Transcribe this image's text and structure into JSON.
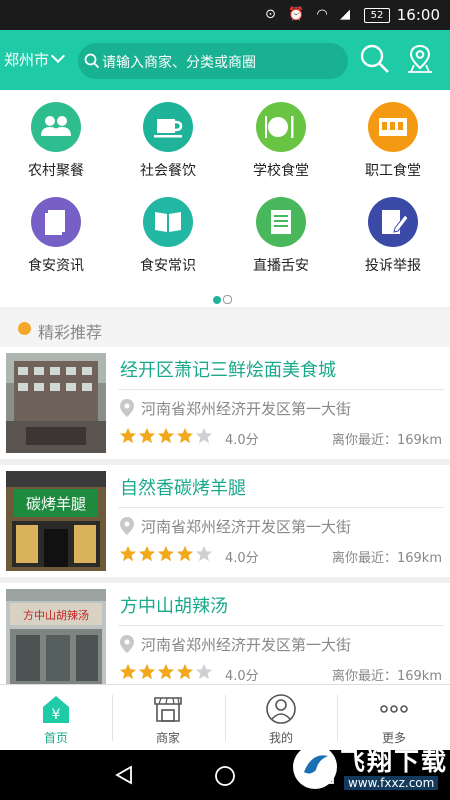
{
  "status_bar": {
    "battery": "52",
    "time": "16:00"
  },
  "header": {
    "city": "郑州市",
    "search_placeholder": "请输入商家、分类或商圈"
  },
  "categories": [
    {
      "label": "农村聚餐",
      "color": "#2ebd8e",
      "icon": "people-icon"
    },
    {
      "label": "社会餐饮",
      "color": "#1fb39a",
      "icon": "cup-icon"
    },
    {
      "label": "学校食堂",
      "color": "#6ac444",
      "icon": "plate-icon"
    },
    {
      "label": "职工食堂",
      "color": "#f49a12",
      "icon": "canteen-icon"
    },
    {
      "label": "食安资讯",
      "color": "#7660c6",
      "icon": "document-icon"
    },
    {
      "label": "食安常识",
      "color": "#21b7a3",
      "icon": "book-icon"
    },
    {
      "label": "直播舌安",
      "color": "#49b85c",
      "icon": "list-icon"
    },
    {
      "label": "投诉举报",
      "color": "#3a4aa6",
      "icon": "report-icon"
    }
  ],
  "section": {
    "title": "精彩推荐"
  },
  "listings": [
    {
      "name": "经开区萧记三鲜烩面美食城",
      "address": "河南省郑州经济开发区第一大街",
      "rating": 4,
      "score": "4.0分",
      "distance": "离你最近：169km"
    },
    {
      "name": "自然香碳烤羊腿",
      "address": "河南省郑州经济开发区第一大街",
      "rating": 4,
      "score": "4.0分",
      "distance": "离你最近：169km"
    },
    {
      "name": "方中山胡辣汤",
      "address": "河南省郑州经济开发区第一大街",
      "rating": 4,
      "score": "4.0分",
      "distance": "离你最近：169km"
    }
  ],
  "thumb_signs": [
    "",
    "碳烤羊腿",
    "方中山胡辣汤"
  ],
  "tabs": [
    {
      "label": "首页",
      "icon": "home-icon",
      "active": true
    },
    {
      "label": "商家",
      "icon": "shop-icon",
      "active": false
    },
    {
      "label": "我的",
      "icon": "user-icon",
      "active": false
    },
    {
      "label": "更多",
      "icon": "more-icon",
      "active": false
    }
  ],
  "watermark": {
    "text": "飞翔下载",
    "url": "www.fxxz.com"
  },
  "colors": {
    "brand": "#1fcaa7",
    "accent": "#1aa98b",
    "star": "#f2a81d",
    "section_dot": "#f4a72a"
  }
}
